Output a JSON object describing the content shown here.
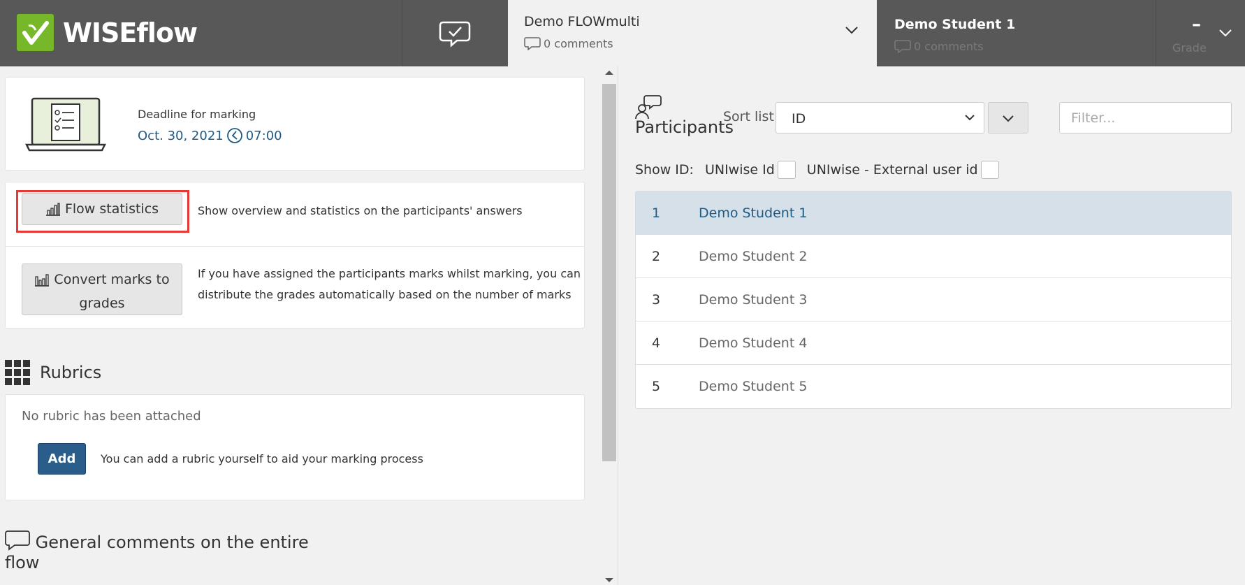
{
  "header": {
    "brand": "WISEflow",
    "flow": {
      "title": "Demo FLOWmulti",
      "comments": "0 comments"
    },
    "student": {
      "name": "Demo Student 1",
      "comments": "0 comments"
    },
    "grade": {
      "value": "–",
      "label": "Grade"
    }
  },
  "deadline": {
    "label": "Deadline for marking",
    "date": "Oct. 30, 2021",
    "time": "07:00"
  },
  "actions": [
    {
      "button": "Flow statistics",
      "description": "Show overview and statistics on the participants' answers"
    },
    {
      "button_line1": "Convert marks to",
      "button_line2": "grades",
      "description_line1": "If you have assigned the participants marks whilst marking, you can",
      "description_line2": "distribute the grades automatically based on the number of marks"
    }
  ],
  "rubrics": {
    "title": "Rubrics",
    "empty": "No rubric has been attached",
    "add_label": "Add",
    "add_desc": "You can add a rubric yourself to aid your marking process"
  },
  "general_comments": {
    "line1": "General comments on the entire",
    "line2": "flow"
  },
  "participants": {
    "title": "Participants",
    "sort_label": "Sort list",
    "sort_value": "ID",
    "filter_placeholder": "Filter...",
    "show_id_label": "Show ID:",
    "id_options": [
      "UNIwise Id",
      "UNIwise - External user id"
    ],
    "rows": [
      {
        "id": "1",
        "name": "Demo Student 1",
        "selected": true
      },
      {
        "id": "2",
        "name": "Demo Student 2"
      },
      {
        "id": "3",
        "name": "Demo Student 3"
      },
      {
        "id": "4",
        "name": "Demo Student 4"
      },
      {
        "id": "5",
        "name": "Demo Student 5"
      }
    ]
  },
  "colors": {
    "header": "#585858",
    "brand_green": "#76b82a",
    "accent_blue": "#2b5d8a",
    "highlight": "#e53935"
  }
}
